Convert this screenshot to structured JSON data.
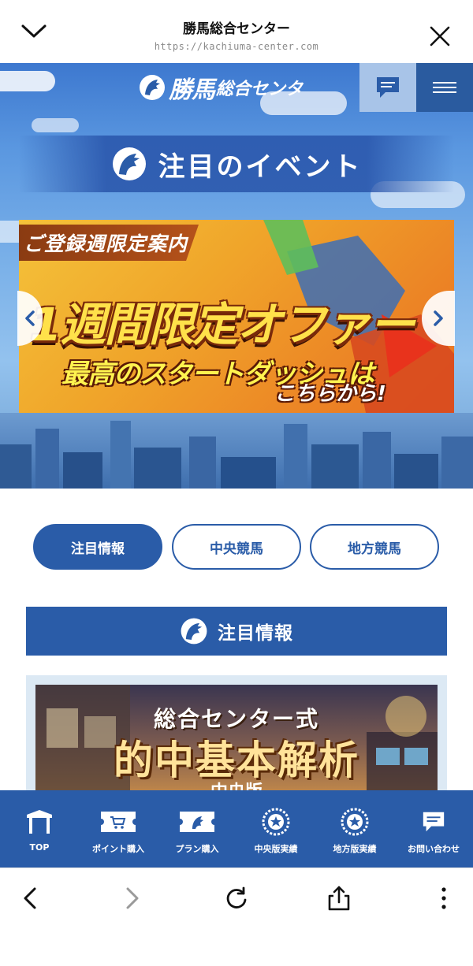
{
  "browser": {
    "title": "勝馬総合センター",
    "url": "https://kachiuma-center.com"
  },
  "site": {
    "logo_text_main": "勝馬",
    "logo_text_sub": "総合センタ",
    "section_title": "注目のイベント"
  },
  "banner": {
    "tag": "ご登録週限定案内",
    "headline": "1週間限定オファー",
    "subline": "最高のスタートダッシュは",
    "subline2": "こちらから!"
  },
  "tabs": [
    {
      "label": "注目情報",
      "active": true
    },
    {
      "label": "中央競馬",
      "active": false
    },
    {
      "label": "地方競馬",
      "active": false
    }
  ],
  "info": {
    "heading": "注目情報",
    "card_line1": "総合センター式",
    "card_line2": "的中基本解析",
    "card_line3": "—中央版—"
  },
  "bottom_nav": [
    {
      "label": "TOP",
      "icon": "gate-icon"
    },
    {
      "label": "ポイント購入",
      "icon": "ticket-cart-icon"
    },
    {
      "label": "プラン購入",
      "icon": "ticket-horse-icon"
    },
    {
      "label": "中央版実績",
      "icon": "medal-icon"
    },
    {
      "label": "地方版実績",
      "icon": "medal-icon"
    },
    {
      "label": "お問い合わせ",
      "icon": "chat-icon"
    }
  ],
  "colors": {
    "brand_blue": "#2a5ca8",
    "tab_active_bg": "#2a5ca8",
    "banner_yellow": "#ffe14a"
  }
}
